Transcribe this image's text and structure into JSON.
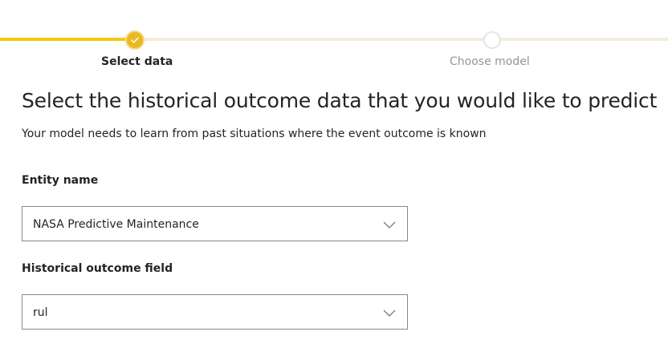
{
  "stepper": {
    "steps": [
      {
        "label": "Select data",
        "status": "complete",
        "icon": "checkmark-icon"
      },
      {
        "label": "Choose model",
        "status": "pending"
      }
    ],
    "colors": {
      "complete": "#f2c811",
      "pending_track": "#f3edd8",
      "pending_label": "#979593"
    }
  },
  "page": {
    "title": "Select the historical outcome data that you would like to predict",
    "subtitle": "Your model needs to learn from past situations where the event outcome is known"
  },
  "form": {
    "entity": {
      "label": "Entity name",
      "value": "NASA Predictive Maintenance",
      "icon": "chevron-down-icon"
    },
    "outcome": {
      "label": "Historical outcome field",
      "value": "rul",
      "icon": "chevron-down-icon"
    }
  }
}
